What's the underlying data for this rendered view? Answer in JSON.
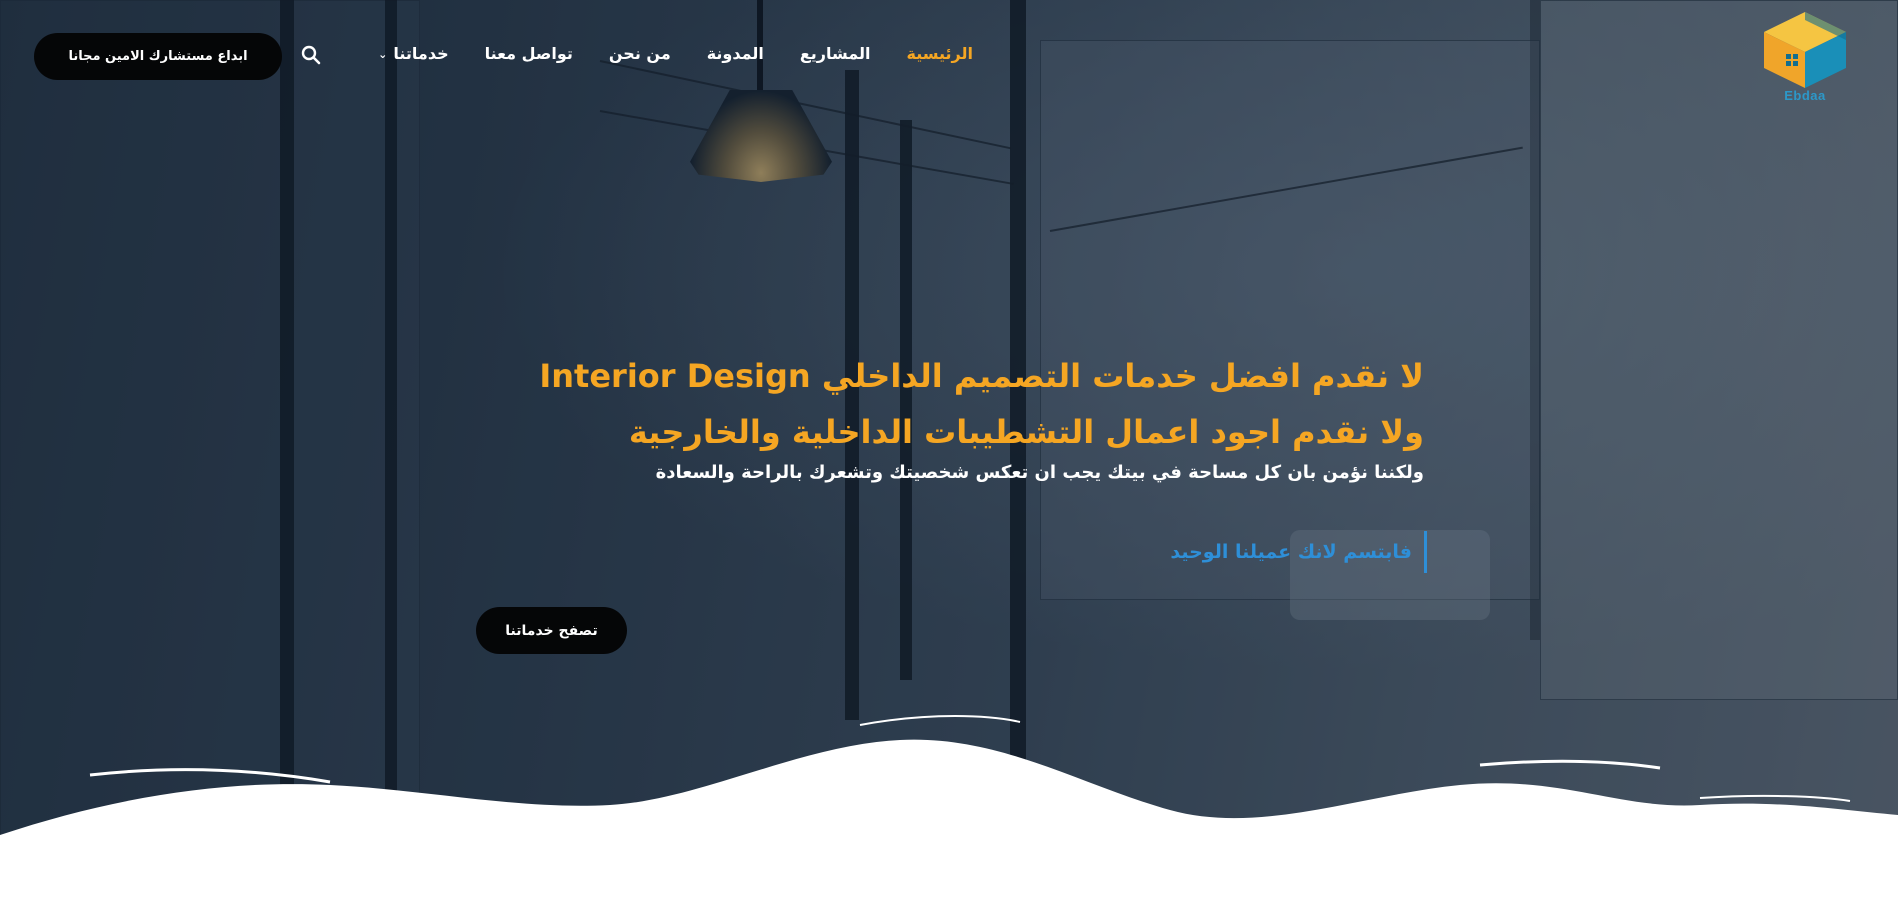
{
  "brand": {
    "logo_label": "Ebdaa",
    "logo_colors": {
      "top": "#f5c542",
      "left": "#f0a52a",
      "right": "#1a8fb8",
      "dark": "#136d8f"
    }
  },
  "nav": {
    "items": [
      {
        "label": "الرئيسية",
        "active": true
      },
      {
        "label": "المشاريع",
        "active": false
      },
      {
        "label": "المدونة",
        "active": false
      },
      {
        "label": "من نحن",
        "active": false
      },
      {
        "label": "تواصل معنا",
        "active": false
      },
      {
        "label": "خدماتنا",
        "active": false,
        "has_dropdown": true
      }
    ],
    "search_icon": "search-icon",
    "cta_label": "ابداع مستشارك الامين مجانا"
  },
  "hero": {
    "headline_line1": "لا نقدم افضل خدمات التصميم الداخلي Interior Design",
    "headline_line2": "ولا نقدم اجود اعمال التشطيبات الداخلية والخارجية",
    "subline": "ولكننا نؤمن بان كل مساحة في بيتك يجب ان تعكس شخصيتك وتشعرك بالراحة والسعادة",
    "quote": "فابتسم لانك عميلنا الوحيد",
    "browse_label": "تصفح خدماتنا"
  },
  "colors": {
    "accent_orange": "#f5a623",
    "accent_blue": "#2e8fd8",
    "button_bg": "#050607",
    "text_white": "#ffffff"
  }
}
